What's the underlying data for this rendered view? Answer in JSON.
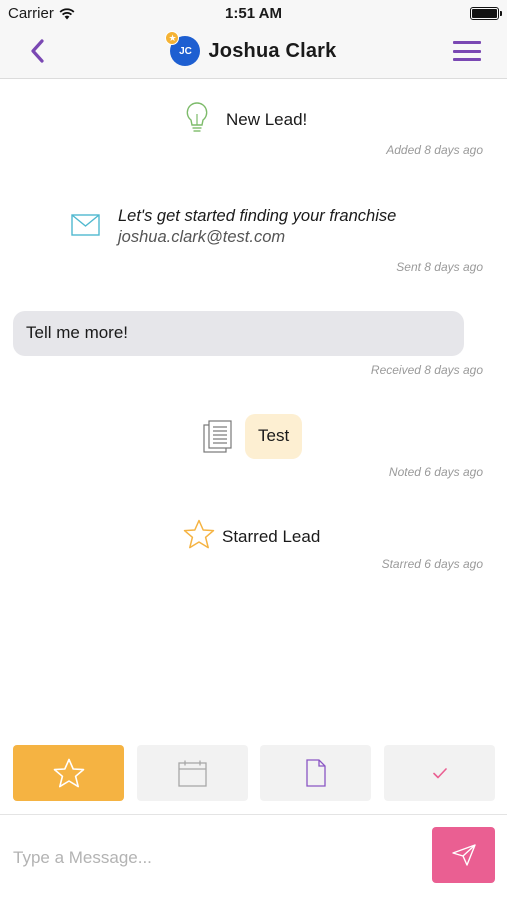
{
  "status_bar": {
    "carrier": "Carrier",
    "time": "1:51 AM"
  },
  "header": {
    "avatar_initials": "JC",
    "title": "Joshua Clark",
    "accent_color": "#7a48b3",
    "avatar_color": "#1e5fd1"
  },
  "timeline": {
    "new_lead": {
      "icon": "lightbulb-icon",
      "text": "New Lead!",
      "timestamp": "Added 8 days ago"
    },
    "email": {
      "icon": "envelope-icon",
      "subject": "Let's get started finding your franchise",
      "address": "joshua.clark@test.com",
      "timestamp": "Sent 8 days ago"
    },
    "message": {
      "text": "Tell me more!",
      "timestamp": "Received 8 days ago"
    },
    "note": {
      "icon": "document-icon",
      "text": "Test",
      "timestamp": "Noted 6 days ago"
    },
    "starred": {
      "icon": "star-icon",
      "text": "Starred Lead",
      "timestamp": "Starred 6 days ago"
    }
  },
  "actions": [
    {
      "icon": "star-icon",
      "active": true,
      "color": "#f5b342"
    },
    {
      "icon": "calendar-icon",
      "active": false
    },
    {
      "icon": "document-icon",
      "active": false
    },
    {
      "icon": "checkmark-icon",
      "active": false
    }
  ],
  "composer": {
    "placeholder": "Type a Message...",
    "send_color": "#ea5f92"
  }
}
